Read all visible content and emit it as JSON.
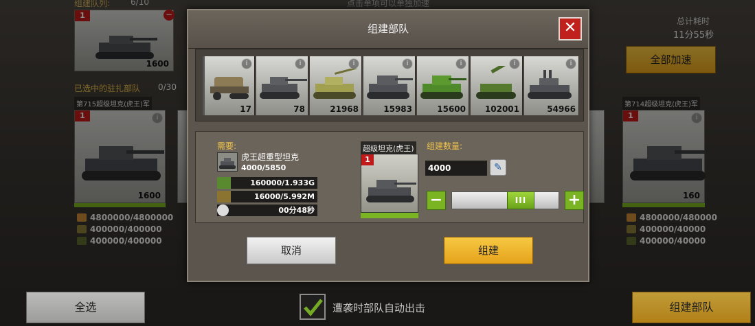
{
  "background": {
    "queue_label": "组建队列:",
    "queue_value": "6/10",
    "top_hint": "点击单项可以单独加速",
    "queue_card_badge": "1",
    "queue_card_number": "1600",
    "garrison_label": "已选中的驻扎部队",
    "garrison_count": "0/30",
    "total_time_label": "总计耗时",
    "total_time_value": "11分55秒",
    "speed_all_button": "全部加速",
    "left_card": {
      "title": "第715超级坦克(虎王)军",
      "badge": "1",
      "number": "1600",
      "resources": [
        "4800000/4800000",
        "400000/400000",
        "400000/400000"
      ]
    },
    "right_card": {
      "title": "第714超级坦克(虎王)军",
      "badge": "1",
      "number": "160",
      "resources": [
        "4800000/480000",
        "400000/40000",
        "400000/40000"
      ]
    },
    "select_all_button": "全选",
    "auto_deploy_label": "遭袭时部队自动出击",
    "form_unit_button": "组建部队"
  },
  "dialog": {
    "title": "组建部队",
    "close_symbol": "✕",
    "units": [
      {
        "icon": "halftrack-icon",
        "count": "17"
      },
      {
        "icon": "tiger-tank-icon",
        "count": "78"
      },
      {
        "icon": "desert-tank-icon",
        "count": "21968"
      },
      {
        "icon": "heavy-tank-icon",
        "count": "15983"
      },
      {
        "icon": "green-tank-icon",
        "count": "15600"
      },
      {
        "icon": "artillery-icon",
        "count": "102001"
      },
      {
        "icon": "aa-tank-icon",
        "count": "54966"
      }
    ],
    "need_label": "需要:",
    "need_unit_name": "虎王超重型坦克",
    "need_unit_count": "4000/5850",
    "need_rows": [
      {
        "icon": "cash-icon",
        "value": "160000/1.933G"
      },
      {
        "icon": "fuel-icon",
        "value": "16000/5.992M"
      },
      {
        "icon": "clock-icon",
        "value": "00分48秒"
      }
    ],
    "super_unit_title": "超级坦克(虎王)",
    "super_unit_badge": "1",
    "quantity_label": "组建数量:",
    "quantity_value": "4000",
    "minus_symbol": "−",
    "plus_symbol": "+",
    "slider_handle_label": "III",
    "slider_fraction": 0.68,
    "cancel_button": "取消",
    "build_button": "组建"
  }
}
